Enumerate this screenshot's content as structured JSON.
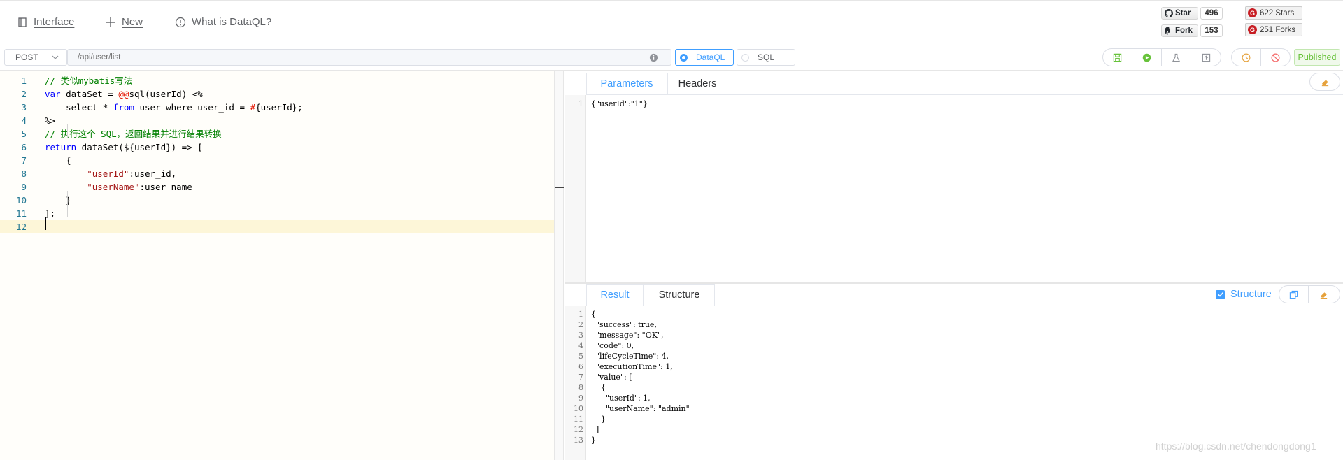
{
  "nav": {
    "interface": "Interface",
    "new": "New",
    "what_is": "What is DataQL?"
  },
  "github": {
    "star_label": "Star",
    "star_count": "496",
    "fork_label": "Fork",
    "fork_count": "153"
  },
  "gitee": {
    "stars": "622 Stars",
    "forks": "251 Forks"
  },
  "toolbar": {
    "method": "POST",
    "path_placeholder": "/api/user/list",
    "radio_dataql": "DataQL",
    "radio_sql": "SQL",
    "selected_type": "DataQL",
    "status": "Published"
  },
  "editor": {
    "lines": [
      {
        "n": "1",
        "parts": [
          {
            "t": "// 类似mybatis写法",
            "c": "com"
          }
        ]
      },
      {
        "n": "2",
        "parts": [
          {
            "t": "var",
            "c": "kw"
          },
          {
            "t": " dataSet = ",
            "c": ""
          },
          {
            "t": "@@",
            "c": "red"
          },
          {
            "t": "sql(userId) <%",
            "c": ""
          }
        ]
      },
      {
        "n": "3",
        "parts": [
          {
            "t": "    select * ",
            "c": ""
          },
          {
            "t": "from",
            "c": "kw"
          },
          {
            "t": " user where user_id = ",
            "c": ""
          },
          {
            "t": "#",
            "c": "red"
          },
          {
            "t": "{userId};",
            "c": ""
          }
        ]
      },
      {
        "n": "4",
        "parts": [
          {
            "t": "%>",
            "c": ""
          }
        ]
      },
      {
        "n": "5",
        "parts": [
          {
            "t": "// 执行这个 SQL，返回结果并进行结果转换",
            "c": "com"
          }
        ]
      },
      {
        "n": "6",
        "parts": [
          {
            "t": "return",
            "c": "kw"
          },
          {
            "t": " dataSet(${userId}) => [",
            "c": ""
          }
        ]
      },
      {
        "n": "7",
        "parts": [
          {
            "t": "    {",
            "c": ""
          }
        ]
      },
      {
        "n": "8",
        "parts": [
          {
            "t": "        ",
            "c": ""
          },
          {
            "t": "\"userId\"",
            "c": "str"
          },
          {
            "t": ":user_id,",
            "c": ""
          }
        ]
      },
      {
        "n": "9",
        "parts": [
          {
            "t": "        ",
            "c": ""
          },
          {
            "t": "\"userName\"",
            "c": "str"
          },
          {
            "t": ":user_name",
            "c": ""
          }
        ]
      },
      {
        "n": "10",
        "parts": [
          {
            "t": "    }",
            "c": ""
          }
        ]
      },
      {
        "n": "11",
        "parts": [
          {
            "t": "];",
            "c": ""
          }
        ]
      },
      {
        "n": "12",
        "parts": [
          {
            "t": "",
            "c": ""
          }
        ]
      }
    ]
  },
  "params": {
    "tab_parameters": "Parameters",
    "tab_headers": "Headers",
    "lines": [
      {
        "n": "1",
        "text": "{\"userId\":\"1\"}"
      }
    ]
  },
  "result": {
    "tab_result": "Result",
    "tab_structure": "Structure",
    "structure_checkbox_label": "Structure",
    "structure_checked": true,
    "lines": [
      {
        "n": "1",
        "text": "{"
      },
      {
        "n": "2",
        "text": "  \"success\": true,"
      },
      {
        "n": "3",
        "text": "  \"message\": \"OK\","
      },
      {
        "n": "4",
        "text": "  \"code\": 0,"
      },
      {
        "n": "5",
        "text": "  \"lifeCycleTime\": 4,"
      },
      {
        "n": "6",
        "text": "  \"executionTime\": 1,"
      },
      {
        "n": "7",
        "text": "  \"value\": ["
      },
      {
        "n": "8",
        "text": "    {"
      },
      {
        "n": "9",
        "text": "      \"userId\": 1,"
      },
      {
        "n": "10",
        "text": "      \"userName\": \"admin\""
      },
      {
        "n": "11",
        "text": "    }"
      },
      {
        "n": "12",
        "text": "  ]"
      },
      {
        "n": "13",
        "text": "}"
      }
    ]
  },
  "watermark": "https://blog.csdn.net/chendongdong1",
  "colors": {
    "accent": "#409eff",
    "success": "#67c23a",
    "danger": "#f56c6c",
    "warning": "#e6a23c",
    "comment": "#008000",
    "keyword": "#0000ff",
    "string": "#a31515"
  }
}
